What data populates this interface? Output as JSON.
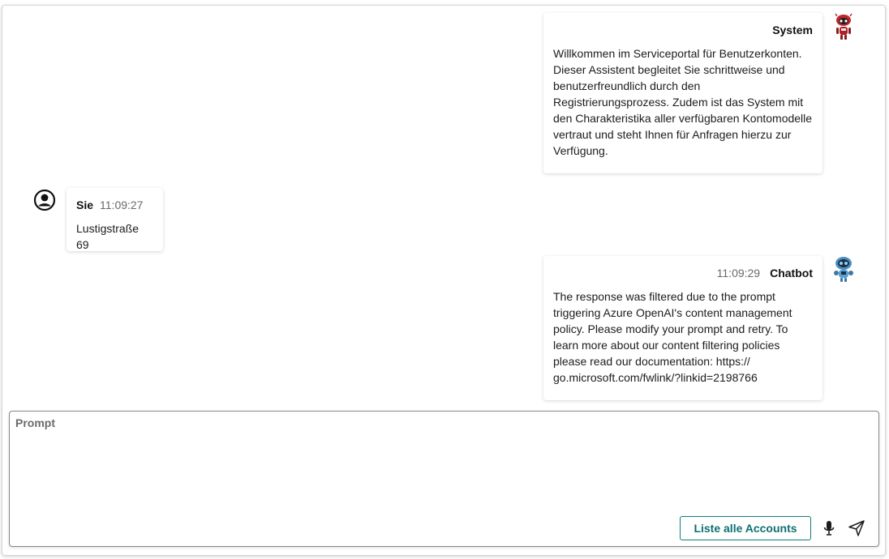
{
  "messages": [
    {
      "author": "System",
      "time": "",
      "text": "Willkommen im Serviceportal für Benutzerkonten.\nDieser Assistent begleitet Sie schrittweise und\nbenutzerfreundlich durch den\nRegistrierungsprozess. Zudem ist das System mit\nden Charakteristika aller verfügbaren Kontomodelle\nvertraut und steht Ihnen für Anfragen hierzu zur\nVerfügung.",
      "avatar": "red-robot-avatar-icon"
    },
    {
      "author": "Sie",
      "time": "11:09:27",
      "text": "Lustigstraße 69",
      "avatar": "user-circle-icon"
    },
    {
      "author": "Chatbot",
      "time": "11:09:29",
      "text": "The response was filtered due to the prompt\ntriggering Azure OpenAI's content management\npolicy. Please modify your prompt and retry. To\nlearn more about our content filtering policies\nplease read our documentation: https://\ngo.microsoft.com/fwlink/?linkid=2198766",
      "avatar": "blue-robot-avatar-icon"
    }
  ],
  "prompt": {
    "label": "Prompt",
    "value": "",
    "accounts_button": "Liste alle Accounts",
    "mic_icon": "microphone-icon",
    "send_icon": "send-icon"
  },
  "colors": {
    "accent": "#0e7d7d",
    "muted_text": "#6a6a6a"
  }
}
